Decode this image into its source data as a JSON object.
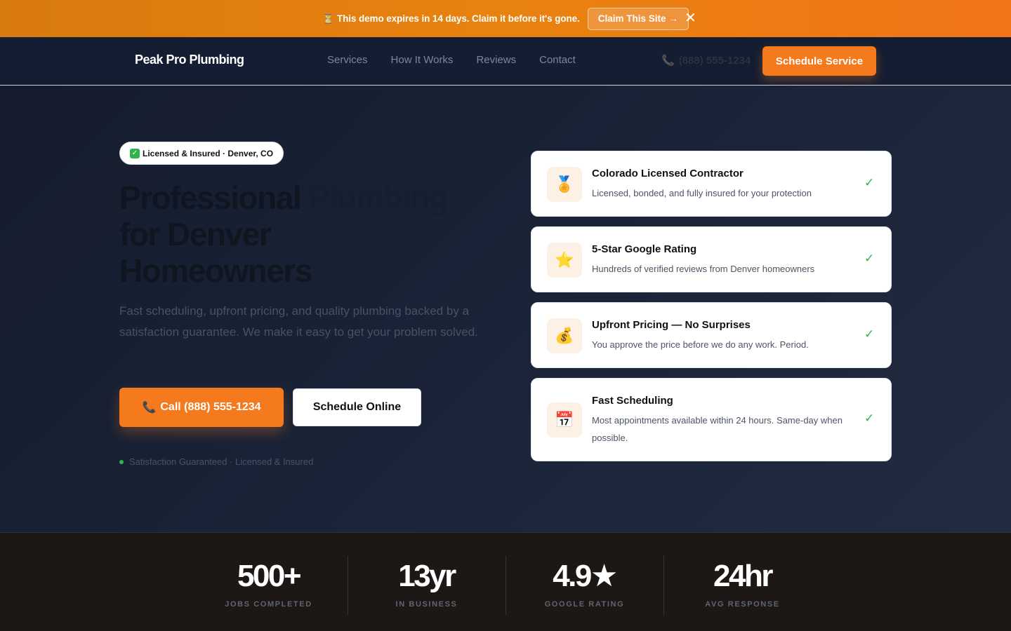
{
  "banner": {
    "icon": "hourglass-icon",
    "text": "This demo expires in 14 days. Claim it before it's gone.",
    "cta_label": "Claim This Site →",
    "close_label": "✕"
  },
  "nav": {
    "logo": "Peak Pro Plumbing",
    "links": [
      "Services",
      "How It Works",
      "Reviews",
      "Contact"
    ],
    "phone": "(888) 555-1234",
    "cta_label": "Schedule Service"
  },
  "hero": {
    "badge": "Licensed & Insured · Denver, CO",
    "headline_line1_a": "Professional",
    "headline_line1_b": "Plumbing",
    "headline_line2": "for Denver",
    "headline_line3": "Homeowners",
    "subtext": "Fast scheduling, upfront pricing, and quality plumbing backed by a satisfaction guarantee. We make it easy to get your problem solved.",
    "call_button": "Call (888) 555-1234",
    "schedule_button": "Schedule Online",
    "guarantee": "Satisfaction Guaranteed · Licensed & Insured"
  },
  "features": [
    {
      "icon": "medal-icon",
      "glyph": "🏅",
      "title": "Colorado Licensed Contractor",
      "desc": "Licensed, bonded, and fully insured for your protection"
    },
    {
      "icon": "star-icon",
      "glyph": "⭐",
      "title": "5-Star Google Rating",
      "desc": "Hundreds of verified reviews from Denver homeowners"
    },
    {
      "icon": "money-bag-icon",
      "glyph": "💰",
      "title": "Upfront Pricing — No Surprises",
      "desc": "You approve the price before we do any work. Period."
    },
    {
      "icon": "calendar-icon",
      "glyph": "📅",
      "title": "Fast Scheduling",
      "desc": "Most appointments available within 24 hours. Same-day when possible."
    }
  ],
  "stats": [
    {
      "value": "500+",
      "label": "JOBS COMPLETED"
    },
    {
      "value": "13yr",
      "label": "IN BUSINESS"
    },
    {
      "value": "4.9★",
      "label": "GOOGLE RATING"
    },
    {
      "value": "24hr",
      "label": "AVG RESPONSE"
    }
  ],
  "colors": {
    "accent": "#f47a1d",
    "navy": "#141d31",
    "success": "#2fb34f"
  }
}
